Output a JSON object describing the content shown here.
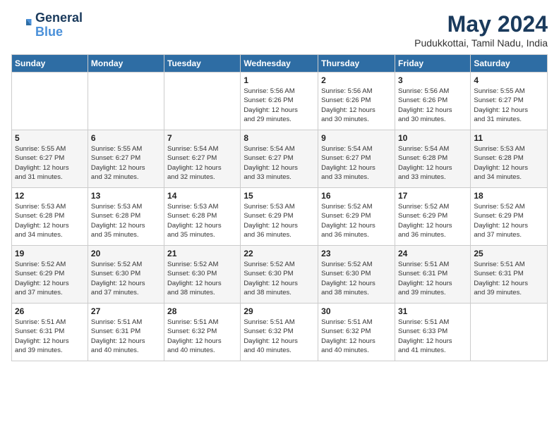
{
  "header": {
    "logo_line1": "General",
    "logo_line2": "Blue",
    "month_title": "May 2024",
    "subtitle": "Pudukkottai, Tamil Nadu, India"
  },
  "days_of_week": [
    "Sunday",
    "Monday",
    "Tuesday",
    "Wednesday",
    "Thursday",
    "Friday",
    "Saturday"
  ],
  "weeks": [
    [
      {
        "num": "",
        "info": ""
      },
      {
        "num": "",
        "info": ""
      },
      {
        "num": "",
        "info": ""
      },
      {
        "num": "1",
        "info": "Sunrise: 5:56 AM\nSunset: 6:26 PM\nDaylight: 12 hours\nand 29 minutes."
      },
      {
        "num": "2",
        "info": "Sunrise: 5:56 AM\nSunset: 6:26 PM\nDaylight: 12 hours\nand 30 minutes."
      },
      {
        "num": "3",
        "info": "Sunrise: 5:56 AM\nSunset: 6:26 PM\nDaylight: 12 hours\nand 30 minutes."
      },
      {
        "num": "4",
        "info": "Sunrise: 5:55 AM\nSunset: 6:27 PM\nDaylight: 12 hours\nand 31 minutes."
      }
    ],
    [
      {
        "num": "5",
        "info": "Sunrise: 5:55 AM\nSunset: 6:27 PM\nDaylight: 12 hours\nand 31 minutes."
      },
      {
        "num": "6",
        "info": "Sunrise: 5:55 AM\nSunset: 6:27 PM\nDaylight: 12 hours\nand 32 minutes."
      },
      {
        "num": "7",
        "info": "Sunrise: 5:54 AM\nSunset: 6:27 PM\nDaylight: 12 hours\nand 32 minutes."
      },
      {
        "num": "8",
        "info": "Sunrise: 5:54 AM\nSunset: 6:27 PM\nDaylight: 12 hours\nand 33 minutes."
      },
      {
        "num": "9",
        "info": "Sunrise: 5:54 AM\nSunset: 6:27 PM\nDaylight: 12 hours\nand 33 minutes."
      },
      {
        "num": "10",
        "info": "Sunrise: 5:54 AM\nSunset: 6:28 PM\nDaylight: 12 hours\nand 33 minutes."
      },
      {
        "num": "11",
        "info": "Sunrise: 5:53 AM\nSunset: 6:28 PM\nDaylight: 12 hours\nand 34 minutes."
      }
    ],
    [
      {
        "num": "12",
        "info": "Sunrise: 5:53 AM\nSunset: 6:28 PM\nDaylight: 12 hours\nand 34 minutes."
      },
      {
        "num": "13",
        "info": "Sunrise: 5:53 AM\nSunset: 6:28 PM\nDaylight: 12 hours\nand 35 minutes."
      },
      {
        "num": "14",
        "info": "Sunrise: 5:53 AM\nSunset: 6:28 PM\nDaylight: 12 hours\nand 35 minutes."
      },
      {
        "num": "15",
        "info": "Sunrise: 5:53 AM\nSunset: 6:29 PM\nDaylight: 12 hours\nand 36 minutes."
      },
      {
        "num": "16",
        "info": "Sunrise: 5:52 AM\nSunset: 6:29 PM\nDaylight: 12 hours\nand 36 minutes."
      },
      {
        "num": "17",
        "info": "Sunrise: 5:52 AM\nSunset: 6:29 PM\nDaylight: 12 hours\nand 36 minutes."
      },
      {
        "num": "18",
        "info": "Sunrise: 5:52 AM\nSunset: 6:29 PM\nDaylight: 12 hours\nand 37 minutes."
      }
    ],
    [
      {
        "num": "19",
        "info": "Sunrise: 5:52 AM\nSunset: 6:29 PM\nDaylight: 12 hours\nand 37 minutes."
      },
      {
        "num": "20",
        "info": "Sunrise: 5:52 AM\nSunset: 6:30 PM\nDaylight: 12 hours\nand 37 minutes."
      },
      {
        "num": "21",
        "info": "Sunrise: 5:52 AM\nSunset: 6:30 PM\nDaylight: 12 hours\nand 38 minutes."
      },
      {
        "num": "22",
        "info": "Sunrise: 5:52 AM\nSunset: 6:30 PM\nDaylight: 12 hours\nand 38 minutes."
      },
      {
        "num": "23",
        "info": "Sunrise: 5:52 AM\nSunset: 6:30 PM\nDaylight: 12 hours\nand 38 minutes."
      },
      {
        "num": "24",
        "info": "Sunrise: 5:51 AM\nSunset: 6:31 PM\nDaylight: 12 hours\nand 39 minutes."
      },
      {
        "num": "25",
        "info": "Sunrise: 5:51 AM\nSunset: 6:31 PM\nDaylight: 12 hours\nand 39 minutes."
      }
    ],
    [
      {
        "num": "26",
        "info": "Sunrise: 5:51 AM\nSunset: 6:31 PM\nDaylight: 12 hours\nand 39 minutes."
      },
      {
        "num": "27",
        "info": "Sunrise: 5:51 AM\nSunset: 6:31 PM\nDaylight: 12 hours\nand 40 minutes."
      },
      {
        "num": "28",
        "info": "Sunrise: 5:51 AM\nSunset: 6:32 PM\nDaylight: 12 hours\nand 40 minutes."
      },
      {
        "num": "29",
        "info": "Sunrise: 5:51 AM\nSunset: 6:32 PM\nDaylight: 12 hours\nand 40 minutes."
      },
      {
        "num": "30",
        "info": "Sunrise: 5:51 AM\nSunset: 6:32 PM\nDaylight: 12 hours\nand 40 minutes."
      },
      {
        "num": "31",
        "info": "Sunrise: 5:51 AM\nSunset: 6:33 PM\nDaylight: 12 hours\nand 41 minutes."
      },
      {
        "num": "",
        "info": ""
      }
    ]
  ]
}
